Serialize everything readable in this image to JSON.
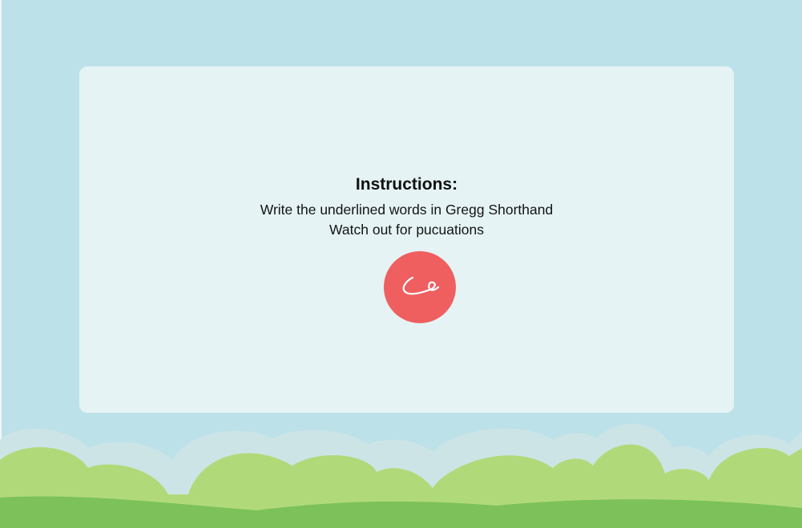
{
  "instructions": {
    "title": "Instructions:",
    "lines": [
      "Write the underlined words in Gregg Shorthand",
      "Watch out for pucuations"
    ]
  },
  "start_button": {
    "icon": "shorthand-stroke-icon"
  },
  "colors": {
    "sky": "#bde1e9",
    "panel": "#e5f3f4",
    "button": "#ef5f60",
    "bush_outline": "#cde4e6",
    "bush": "#b0da7a",
    "ground": "#7dc15a"
  }
}
